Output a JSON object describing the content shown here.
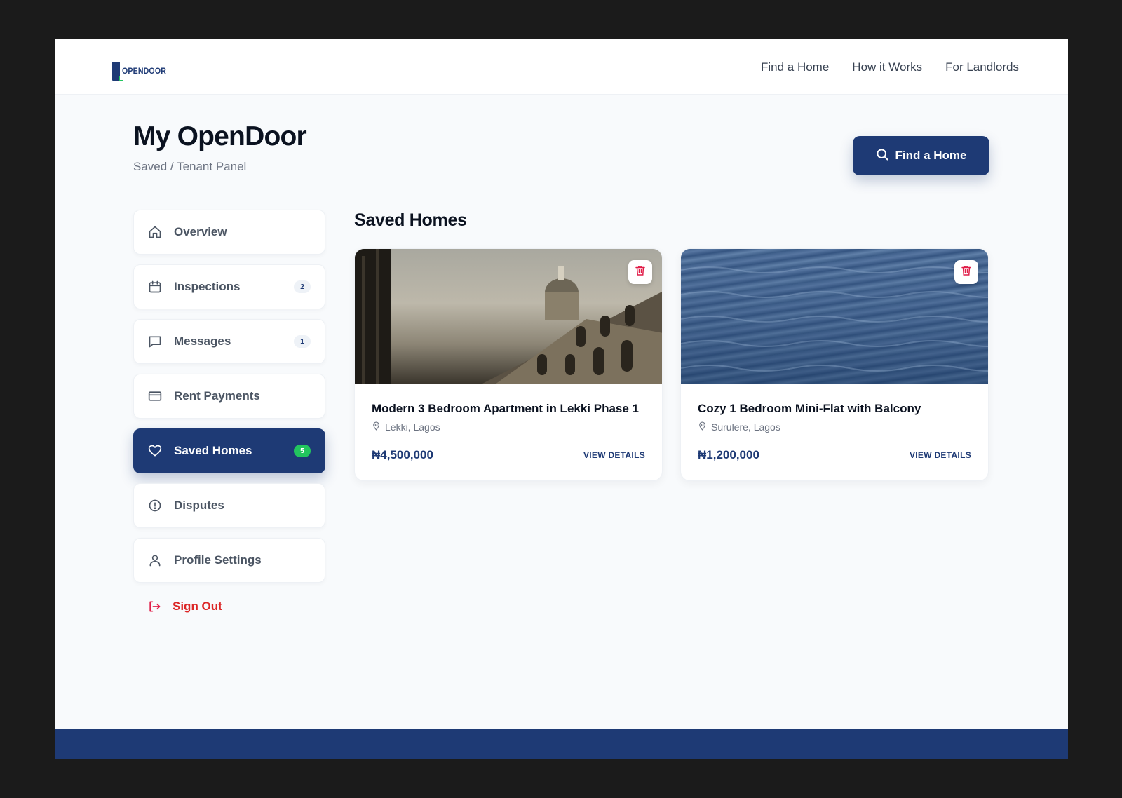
{
  "brand": {
    "logo_text": "OPENDOOR"
  },
  "topnav": {
    "items": [
      {
        "label": "Find a Home"
      },
      {
        "label": "How it Works"
      },
      {
        "label": "For Landlords"
      }
    ]
  },
  "page": {
    "title": "My OpenDoor",
    "breadcrumb": "Saved / Tenant Panel",
    "find_button": "Find a Home"
  },
  "sidebar": {
    "items": [
      {
        "label": "Overview",
        "icon": "home-icon",
        "badge": ""
      },
      {
        "label": "Inspections",
        "icon": "calendar-icon",
        "badge": "2"
      },
      {
        "label": "Messages",
        "icon": "chat-icon",
        "badge": "1"
      },
      {
        "label": "Rent Payments",
        "icon": "credit-card-icon",
        "badge": ""
      },
      {
        "label": "Saved Homes",
        "icon": "heart-icon",
        "badge": "5",
        "active": true
      },
      {
        "label": "Disputes",
        "icon": "alert-circle-icon",
        "badge": ""
      },
      {
        "label": "Profile Settings",
        "icon": "user-icon",
        "badge": ""
      }
    ],
    "signout": "Sign Out"
  },
  "main": {
    "section_title": "Saved Homes",
    "cards": [
      {
        "title": "Modern 3 Bedroom Apartment in Lekki Phase 1",
        "location": "Lekki, Lagos",
        "price": "₦4,500,000",
        "action": "VIEW DETAILS",
        "image": "building-photo"
      },
      {
        "title": "Cozy 1 Bedroom Mini-Flat with Balcony",
        "location": "Surulere, Lagos",
        "price": "₦1,200,000",
        "action": "VIEW DETAILS",
        "image": "water-photo"
      }
    ]
  },
  "colors": {
    "primary": "#1e3a75",
    "accent": "#22c55e",
    "danger": "#dc2626",
    "background": "#f8fafc"
  }
}
